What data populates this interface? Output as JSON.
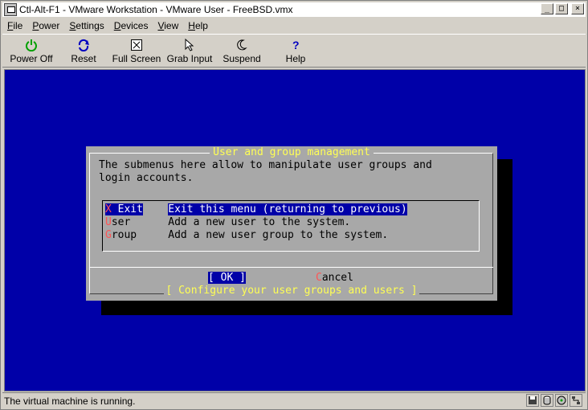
{
  "window": {
    "title": "Ctl-Alt-F1 - VMware Workstation - VMware User - FreeBSD.vmx",
    "btn_min": "_",
    "btn_max": "□",
    "btn_close": "×"
  },
  "menubar": {
    "items": [
      {
        "u": "F",
        "rest": "ile"
      },
      {
        "u": "P",
        "rest": "ower"
      },
      {
        "u": "S",
        "rest": "ettings"
      },
      {
        "u": "D",
        "rest": "evices"
      },
      {
        "u": "V",
        "rest": "iew"
      },
      {
        "u": "H",
        "rest": "elp"
      }
    ]
  },
  "toolbar": {
    "items": [
      {
        "label": "Power Off",
        "icon": "power-icon"
      },
      {
        "label": "Reset",
        "icon": "reset-icon"
      },
      {
        "label": "Full Screen",
        "icon": "fullscreen-icon"
      },
      {
        "label": "Grab Input",
        "icon": "grab-input-icon"
      },
      {
        "label": "Suspend",
        "icon": "suspend-icon"
      },
      {
        "label": "Help",
        "icon": "help-icon"
      }
    ]
  },
  "dialog": {
    "title": "User and group management",
    "text_line1": "The submenus here allow to manipulate user groups and",
    "text_line2": "login accounts.",
    "items": [
      {
        "key": "X",
        "tag_rest": " Exit",
        "desc": "Exit this menu (returning to previous)"
      },
      {
        "key": "U",
        "tag_rest": "ser",
        "desc": "Add a new user to the system."
      },
      {
        "key": "G",
        "tag_rest": "roup",
        "desc": "Add a new user group to the system."
      }
    ],
    "ok_open": "[ ",
    "ok_label": "OK",
    "ok_close": " ]",
    "cancel_key": "C",
    "cancel_rest": "ancel",
    "footer": "[ Configure your user groups and users ]"
  },
  "status": {
    "text": "The virtual machine is running."
  },
  "colors": {
    "vm_background": "#0000a8",
    "dialog_background": "#a8a8a8",
    "hotkey": "#ff5454",
    "dialog_title": "#ffff54"
  }
}
